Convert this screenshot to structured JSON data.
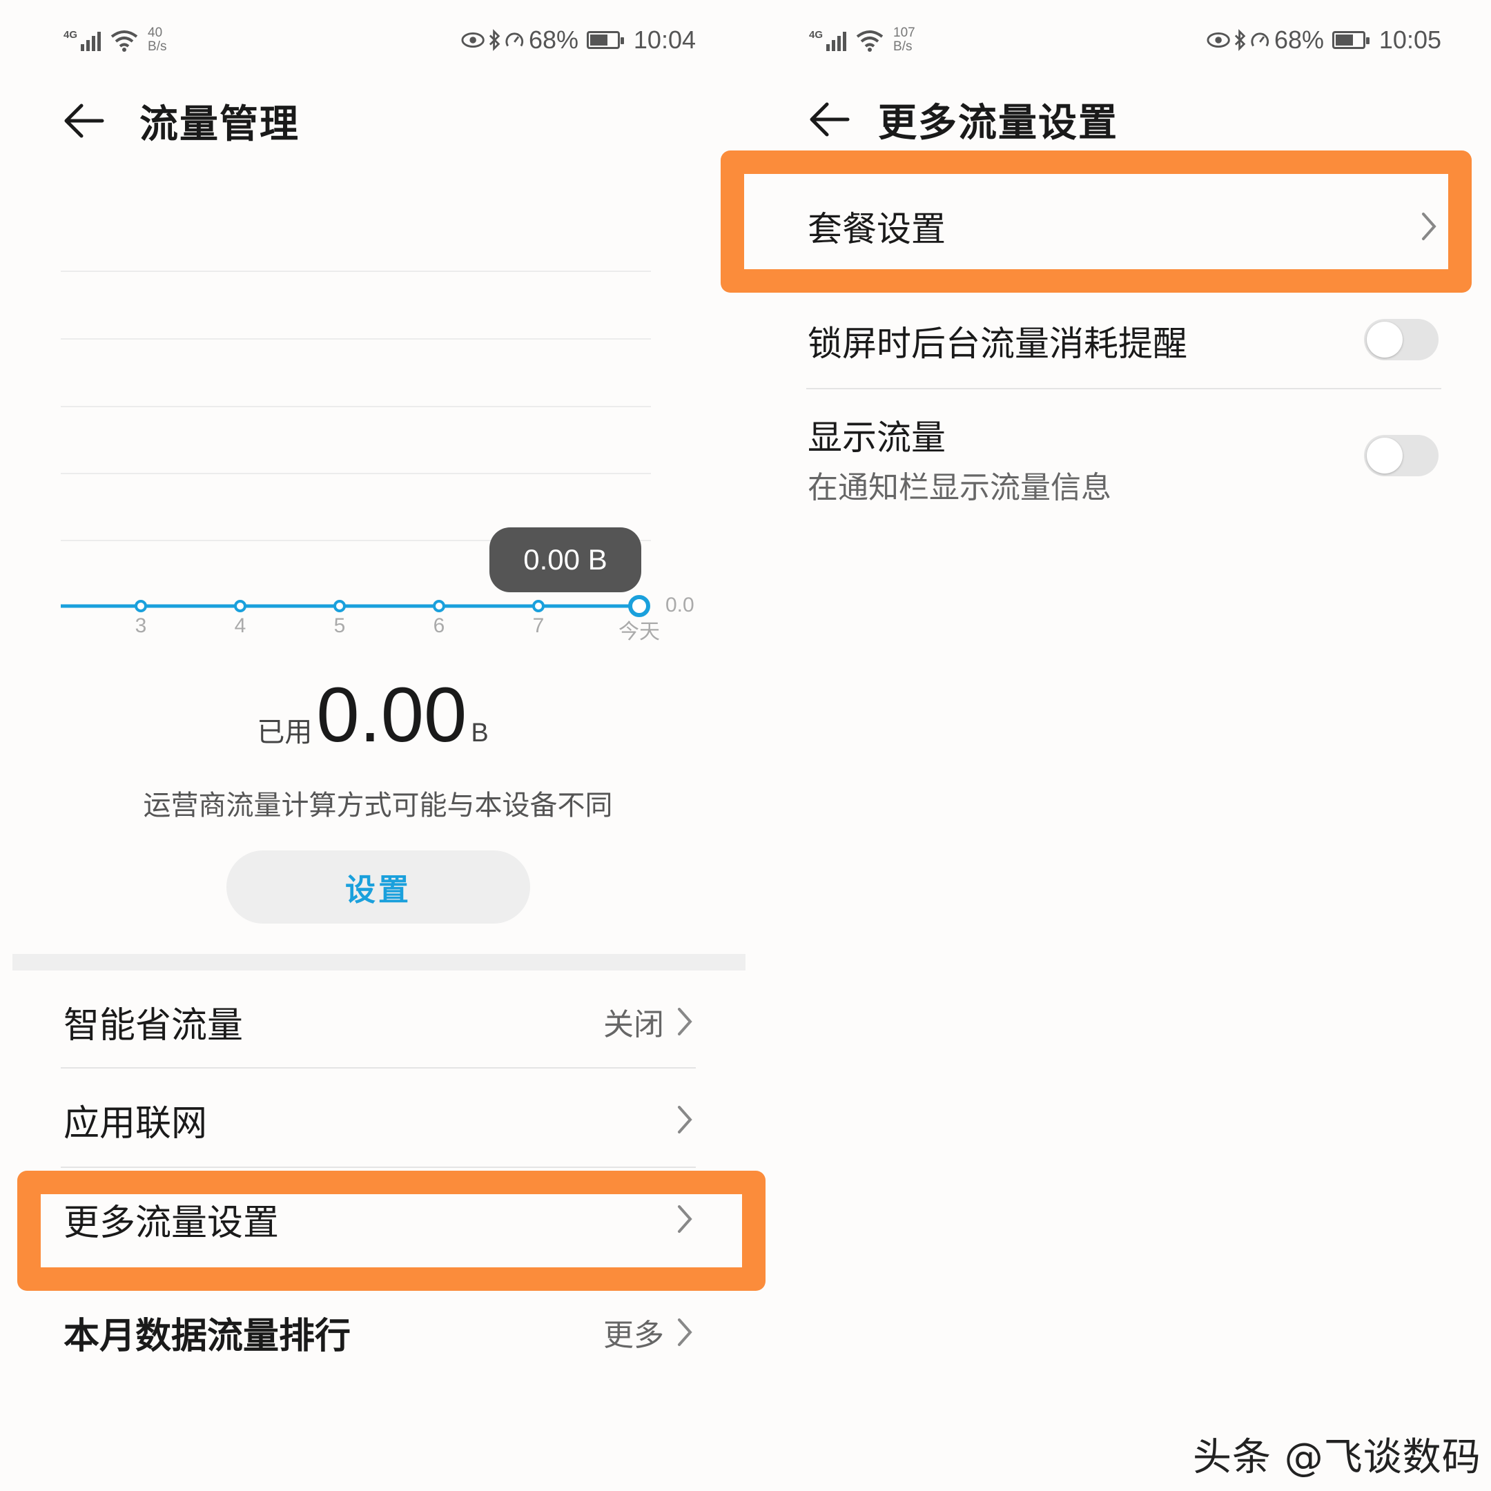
{
  "left": {
    "status": {
      "network": "4G",
      "speed_value": "40",
      "speed_unit": "B/s",
      "battery": "68%",
      "time": "10:04"
    },
    "title": "流量管理",
    "chart_data": {
      "type": "line",
      "categories": [
        "3",
        "4",
        "5",
        "6",
        "7",
        "今天"
      ],
      "values": [
        0,
        0,
        0,
        0,
        0,
        0
      ],
      "y_tick_label": "0.0",
      "tooltip": "0.00 B",
      "colors": {
        "line": "#1aa0dc"
      }
    },
    "usage": {
      "prefix": "已用",
      "value": "0.00",
      "unit": "B"
    },
    "note": "运营商流量计算方式可能与本设备不同",
    "settings_button": "设置",
    "menu": [
      {
        "label": "智能省流量",
        "value": "关闭"
      },
      {
        "label": "应用联网",
        "value": ""
      },
      {
        "label": "更多流量设置",
        "value": "",
        "highlighted": true
      },
      {
        "label": "本月数据流量排行",
        "value": "更多"
      }
    ]
  },
  "right": {
    "status": {
      "network": "4G",
      "speed_value": "107",
      "speed_unit": "B/s",
      "battery": "68%",
      "time": "10:05"
    },
    "title": "更多流量设置",
    "items": [
      {
        "label": "套餐设置",
        "highlighted": true
      },
      {
        "label": "锁屏时后台流量消耗提醒",
        "toggle": false
      },
      {
        "label": "显示流量",
        "sublabel": "在通知栏显示流量信息",
        "toggle": false
      }
    ]
  },
  "watermark": "头条 @飞谈数码",
  "accent_color": "#1aa0dc",
  "highlight_color": "#fb8c3b"
}
